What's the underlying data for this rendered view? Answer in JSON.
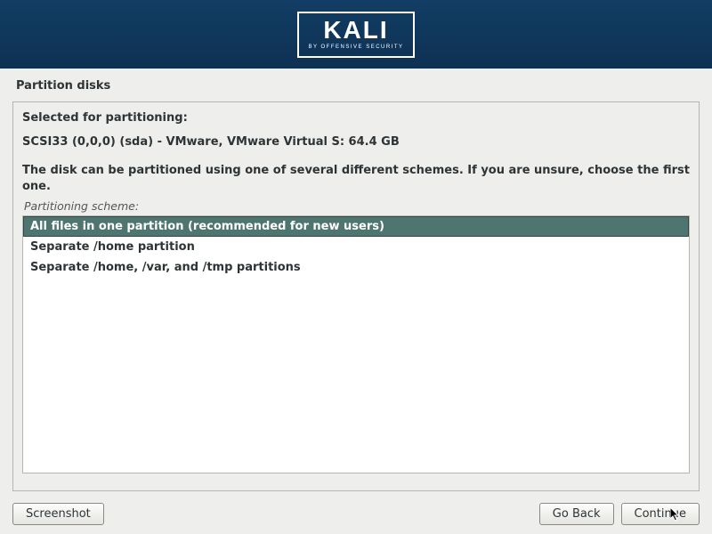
{
  "header": {
    "logo_main": "KALI",
    "logo_sub": "BY OFFENSIVE SECURITY"
  },
  "page": {
    "title": "Partition disks"
  },
  "panel": {
    "heading": "Selected for partitioning:",
    "disk": "SCSI33 (0,0,0) (sda) - VMware, VMware Virtual S: 64.4 GB",
    "description": "The disk can be partitioned using one of several different schemes. If you are unsure, choose the first one.",
    "field_label": "Partitioning scheme:",
    "options": [
      "All files in one partition (recommended for new users)",
      "Separate /home partition",
      "Separate /home, /var, and /tmp partitions"
    ],
    "selected_index": 0
  },
  "buttons": {
    "screenshot": "Screenshot",
    "go_back": "Go Back",
    "continue": "Continue"
  }
}
